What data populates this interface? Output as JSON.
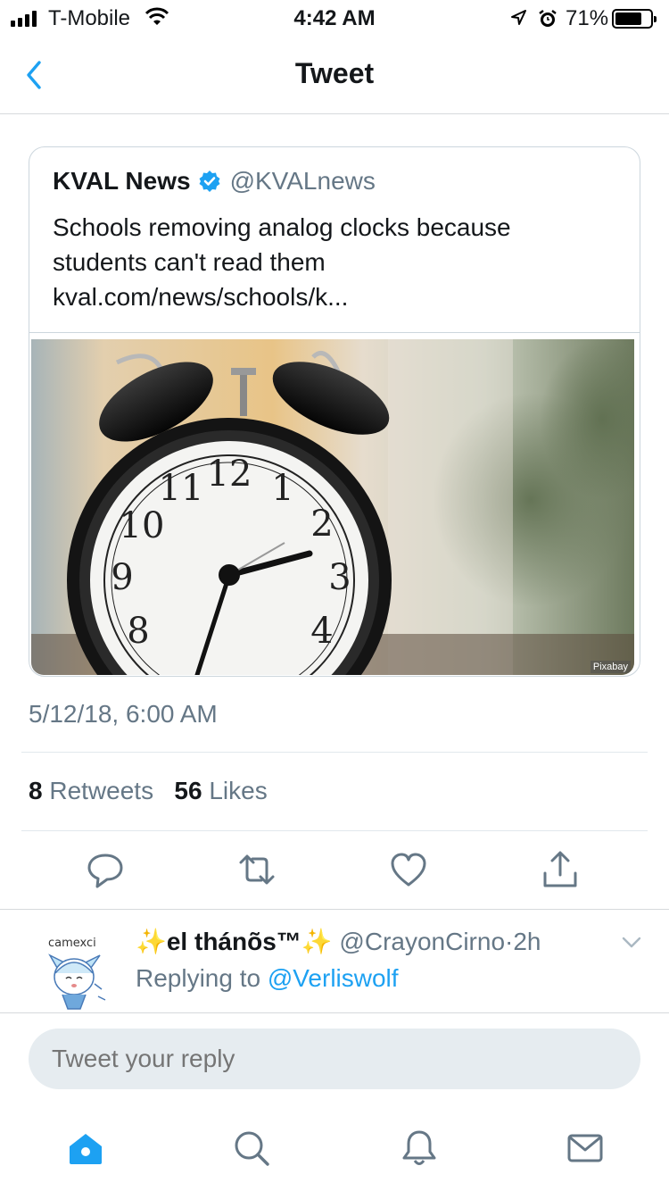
{
  "status_bar": {
    "carrier": "T-Mobile",
    "time": "4:42 AM",
    "battery": "71%",
    "battery_level": 0.71,
    "icons": [
      "signal-icon",
      "wifi-icon",
      "location-icon",
      "alarm-icon",
      "battery-icon"
    ]
  },
  "nav": {
    "back_icon": "chevron-left-icon",
    "title": "Tweet"
  },
  "tweet": {
    "quoted": {
      "name": "KVAL News",
      "verified_icon": "verified-badge-icon",
      "handle": "@KVALnews",
      "text": "Schools removing analog clocks because students can't read them kval.com/news/schools/k...",
      "image_credit": "Pixabay"
    },
    "timestamp": "5/12/18, 6:00 AM",
    "retweet_count": "8",
    "retweet_label": "Retweets",
    "like_count": "56",
    "like_label": "Likes",
    "actions": [
      "reply-icon",
      "retweet-icon",
      "like-icon",
      "share-icon"
    ]
  },
  "reply": {
    "avatar_caption": "camexci",
    "name": "✨el thánõs™✨",
    "handle": "@CrayonCirno",
    "separator": "·",
    "age": "2h",
    "replying_prefix": "Replying to",
    "replying_to": "@Verliswolf"
  },
  "composer": {
    "placeholder": "Tweet your reply"
  },
  "tab_bar": {
    "tabs": [
      "home-icon",
      "search-icon",
      "notifications-icon",
      "messages-icon"
    ]
  },
  "colors": {
    "accent": "#1da1f2",
    "secondary_text": "#657786",
    "divider": "#e1e8ed",
    "composer_bg": "#e6ecf0"
  }
}
